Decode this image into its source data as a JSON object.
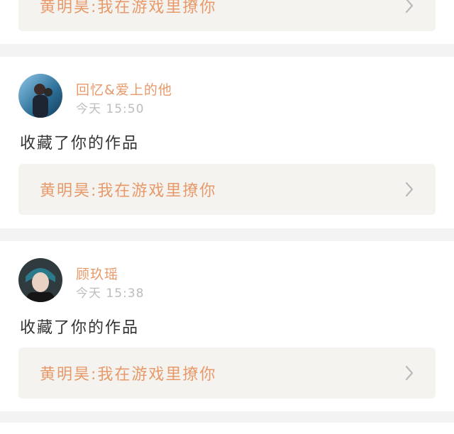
{
  "work_title": "黄明昊:我在游戏里撩你",
  "notifications": [
    {
      "user": "",
      "time": "",
      "action": "",
      "work": "黄明昊:我在游戏里撩你"
    },
    {
      "user": "回忆&爱上的他",
      "time": "今天 15:50",
      "action": "收藏了你的作品",
      "work": "黄明昊:我在游戏里撩你"
    },
    {
      "user": "顾玖瑶",
      "time": "今天 15:38",
      "action": "收藏了你的作品",
      "work": "黄明昊:我在游戏里撩你"
    }
  ],
  "icons": {
    "chevron": "chevron-right-icon",
    "avatar": "avatar"
  },
  "colors": {
    "accent": "#e8996a",
    "text": "#333333",
    "muted": "#bdbdbd",
    "bar_bg": "#f4f3ef"
  }
}
